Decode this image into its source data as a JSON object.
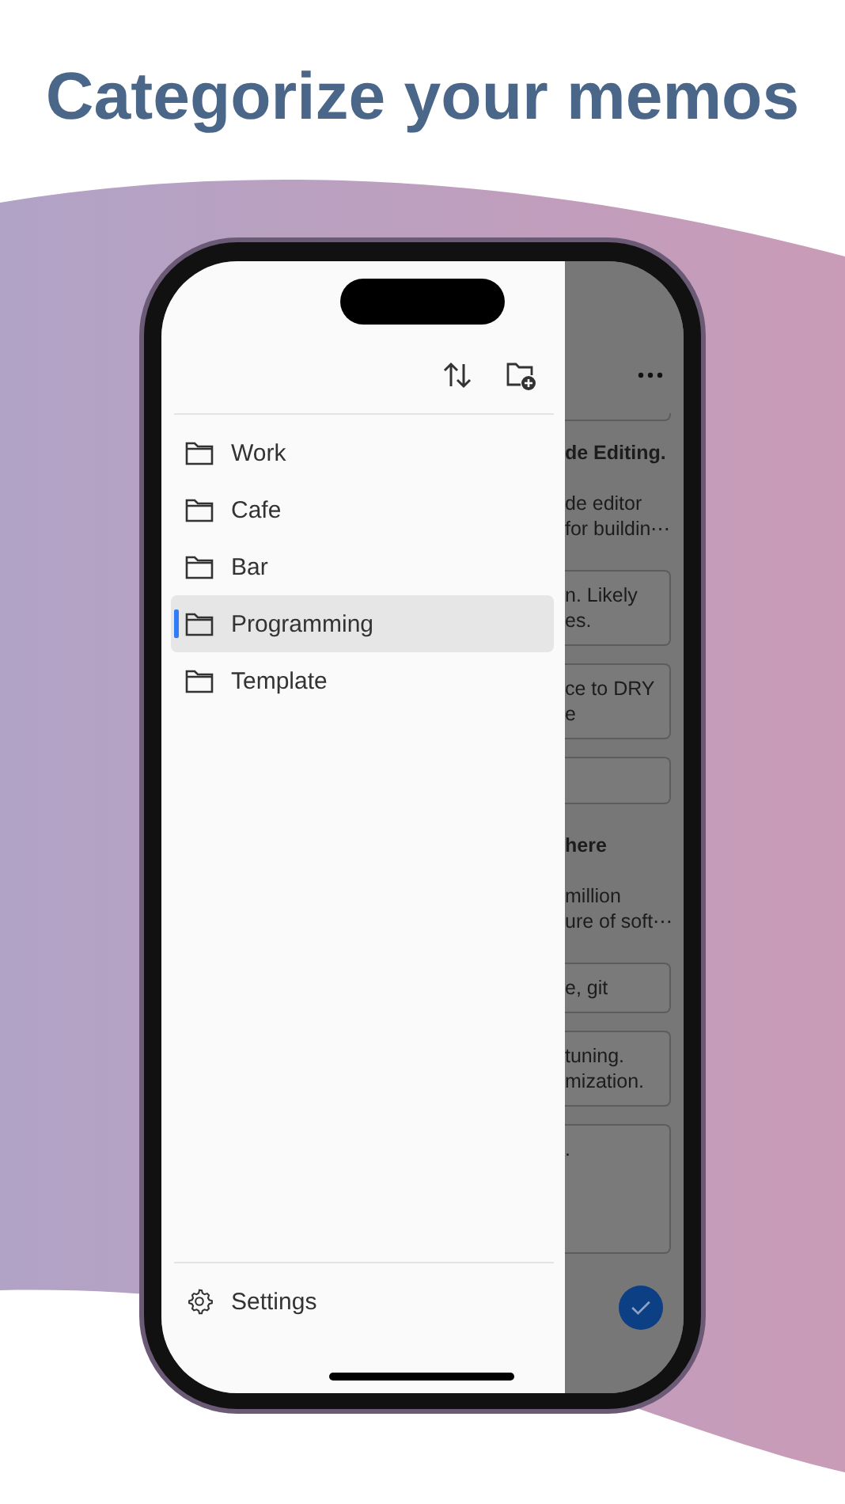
{
  "headline": "Categorize your memos",
  "drawer": {
    "folders": [
      {
        "name": "Work",
        "selected": false
      },
      {
        "name": "Cafe",
        "selected": false
      },
      {
        "name": "Bar",
        "selected": false
      },
      {
        "name": "Programming",
        "selected": true
      },
      {
        "name": "Template",
        "selected": false
      }
    ],
    "settings": "Settings"
  },
  "memo_list": [
    {
      "kind": "card_edge"
    },
    {
      "kind": "note",
      "title": "de Editing.",
      "lines": [
        "de editor",
        "for buildin⋯"
      ]
    },
    {
      "kind": "card",
      "lines": [
        "n. Likely",
        "es."
      ]
    },
    {
      "kind": "card",
      "lines": [
        "ce to DRY",
        "e"
      ]
    },
    {
      "kind": "card"
    },
    {
      "kind": "note",
      "title": "here",
      "lines": [
        "million",
        "ure of soft⋯"
      ]
    },
    {
      "kind": "card",
      "lines": [
        "e, git"
      ]
    },
    {
      "kind": "card",
      "lines": [
        "tuning.",
        "mization."
      ]
    },
    {
      "kind": "card",
      "lines": [
        "."
      ]
    }
  ]
}
